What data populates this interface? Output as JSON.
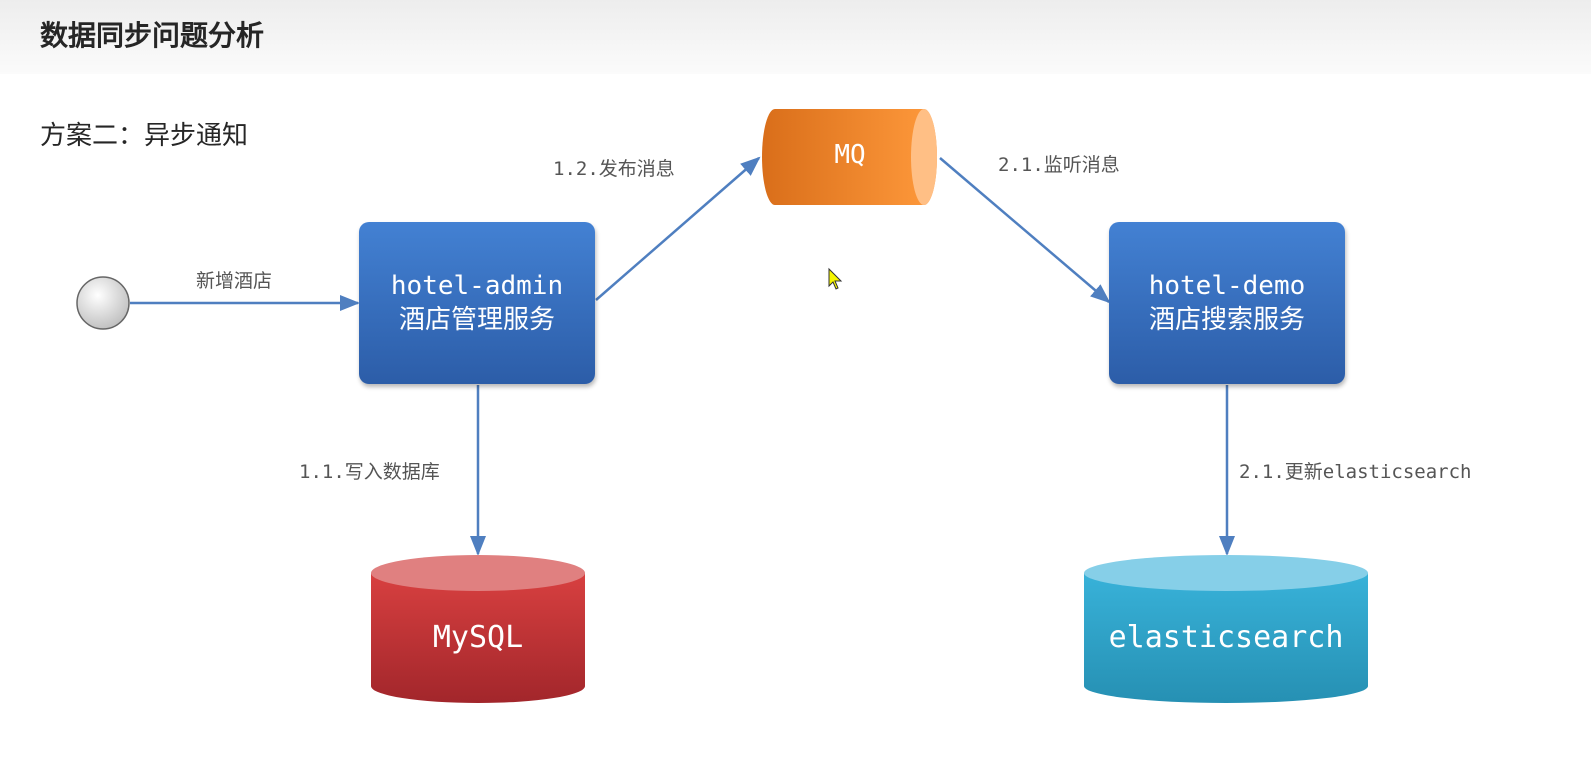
{
  "title": "数据同步问题分析",
  "subtitle": "方案二：异步通知",
  "nodes": {
    "hotel_admin": {
      "name": "hotel-admin",
      "desc": "酒店管理服务"
    },
    "hotel_demo": {
      "name": "hotel-demo",
      "desc": "酒店搜索服务"
    },
    "mq": "MQ",
    "mysql": "MySQL",
    "elasticsearch": "elasticsearch"
  },
  "edges": {
    "add_hotel": "新增酒店",
    "write_db": "1.1.写入数据库",
    "publish": "1.2.发布消息",
    "listen": "2.1.监听消息",
    "update_es": "2.1.更新elasticsearch"
  },
  "colors": {
    "service": "#3a74c4",
    "mq": "#f08a24",
    "mysql": "#c7373a",
    "elasticsearch": "#34a9cf",
    "arrow": "#4f7fc0"
  }
}
